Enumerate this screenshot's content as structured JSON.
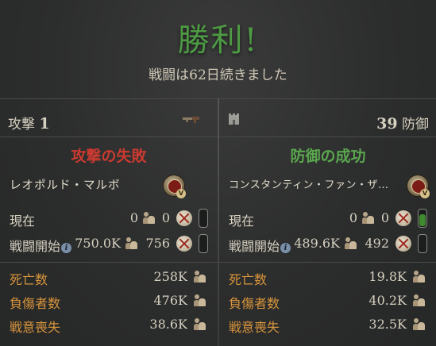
{
  "header": {
    "title": "勝利!",
    "subtitle": "戦闘は62日続きました"
  },
  "attacker": {
    "side_label": "攻撃",
    "side_number": "1",
    "outcome": "攻撃の失敗",
    "commander": "レオポルド・マルボ",
    "medal_badge": "V",
    "current_label": "現在",
    "current_troops": "0",
    "current_casualties": "0",
    "current_morale_fraction": 0.0,
    "start_label": "戦闘開始",
    "start_troops": "750.0K",
    "start_casualties": "756",
    "start_morale_fraction": 0.0,
    "stats": [
      {
        "label": "死亡数",
        "value": "258K"
      },
      {
        "label": "負傷者数",
        "value": "476K"
      },
      {
        "label": "戦意喪失",
        "value": "38.6K"
      }
    ]
  },
  "defender": {
    "side_label": "防御",
    "side_number": "39",
    "outcome": "防御の成功",
    "commander": "コンスタンティン・ファン・ザ…",
    "medal_badge": "V",
    "current_label": "現在",
    "current_troops": "0",
    "current_casualties": "0",
    "current_morale_fraction": 0.85,
    "start_label": "戦闘開始",
    "start_troops": "489.6K",
    "start_casualties": "492",
    "start_morale_fraction": 0.0,
    "stats": [
      {
        "label": "死亡数",
        "value": "19.8K"
      },
      {
        "label": "負傷者数",
        "value": "40.2K"
      },
      {
        "label": "戦意喪失",
        "value": "32.5K"
      }
    ]
  },
  "colors": {
    "victory_green": "#4e9a44",
    "fail_red": "#c93a30",
    "success_green": "#5aa64e",
    "stat_orange": "#d8953c"
  },
  "icons": {
    "info": "i"
  }
}
